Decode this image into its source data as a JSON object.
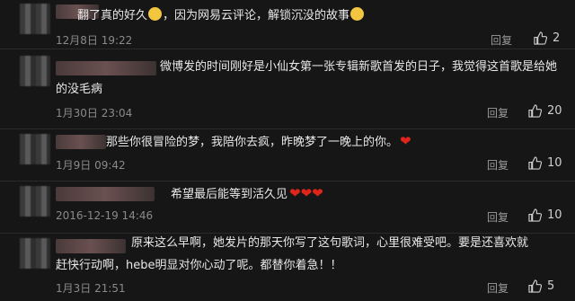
{
  "comments": [
    {
      "lines": [
        "翻了真的好久",
        "，因为网易云评论，解锁沉没的故事"
      ],
      "time": "12月8日 19:22",
      "reply": "回复",
      "likes": "2"
    },
    {
      "lines": [
        "微博发的时间刚好是小仙女第一张专辑新歌首发的日子，我觉得这首歌是给她",
        "的没毛病"
      ],
      "time": "1月30日 23:04",
      "reply": "回复",
      "likes": "20"
    },
    {
      "lines": [
        "那些你很冒险的梦，我陪你去疯，昨晚梦了一晚上的你。"
      ],
      "time": "1月9日 09:42",
      "reply": "回复",
      "likes": "10"
    },
    {
      "lines": [
        "希望最后能等到活久见"
      ],
      "time": "2016-12-19 14:46",
      "reply": "回复",
      "likes": "10"
    },
    {
      "lines": [
        "原来这么早啊，她发片的那天你写了这句歌词，心里很难受吧。要是还喜欢就",
        "赶快行动啊，hebe明显对你心动了呢。都替你着急！！"
      ],
      "time": "1月3日 21:51",
      "reply": "回复",
      "likes": "5"
    }
  ],
  "icons": {
    "like": "thumbs-up-icon",
    "emoji": "emoji-icon",
    "heart": "heart-icon"
  },
  "colors": {
    "background": "#161616",
    "heart": "#e0251b",
    "emoji": "#f3c63f"
  }
}
